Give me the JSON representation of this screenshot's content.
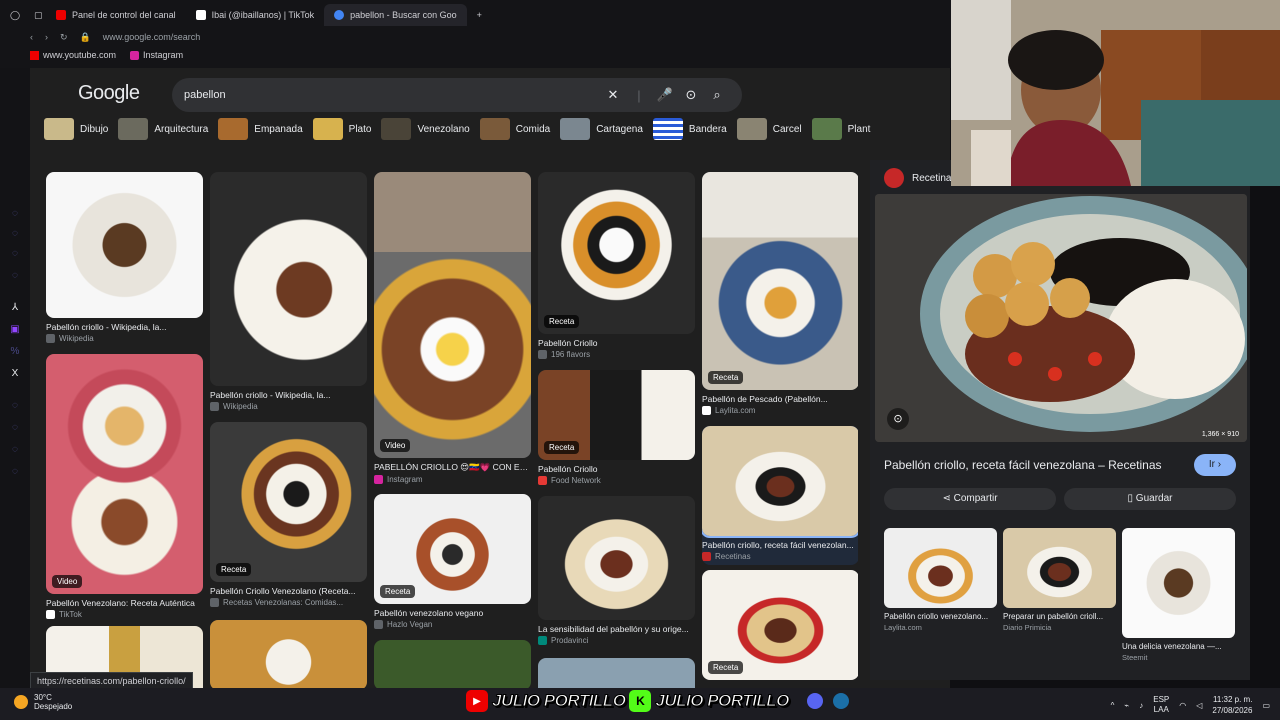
{
  "browser": {
    "tabs": [
      {
        "label": "Panel de control del canal",
        "color": "#e00"
      },
      {
        "label": "Ibai (@ibaillanos) | TikTok",
        "color": "#fff"
      },
      {
        "label": "pabellon - Buscar con Goo",
        "color": "#4285f4",
        "active": true
      }
    ],
    "url": "www.google.com/search",
    "bookmarks": [
      "www.youtube.com",
      "Instagram"
    ]
  },
  "google": {
    "logo": "Google",
    "query": "pabellon",
    "chips": [
      "Dibujo",
      "Arquitectura",
      "Empanada",
      "Plato",
      "Venezolano",
      "Comida",
      "Cartagena",
      "Bandera",
      "Carcel",
      "Plant"
    ]
  },
  "results": [
    {
      "title": "Pabellón criollo - Wikipedia, la...",
      "source": "Wikipedia",
      "badge": ""
    },
    {
      "title": "Pabellón Venezolano: Receta Auténtica",
      "source": "TikTok",
      "badge": "Video"
    },
    {
      "title": "Pabellón criollo - Wikipedia, la...",
      "source": "Wikipedia",
      "badge": ""
    },
    {
      "title": "Pabellón Criollo Venezolano (Receta...",
      "source": "Recetas Venezolanas: Comidas...",
      "badge": "Receta"
    },
    {
      "title": "PABELLÓN CRIOLLO 😍🇻🇪💗 CON EL...",
      "source": "Instagram",
      "badge": "Video"
    },
    {
      "title": "Pabellón venezolano vegano",
      "source": "Hazlo Vegan",
      "badge": "Receta"
    },
    {
      "title": "Pabellón Criollo",
      "source": "196 flavors",
      "badge": "Receta"
    },
    {
      "title": "Pabellón Criollo",
      "source": "Food Network",
      "badge": "Receta"
    },
    {
      "title": "La sensibilidad del pabellón y su orige...",
      "source": "Prodavinci",
      "badge": ""
    },
    {
      "title": "Pabellón de Pescado (Pabellón...",
      "source": "Laylita.com",
      "badge": "Receta"
    },
    {
      "title": "Pabellón criollo, receta fácil venezolan...",
      "source": "Recetinas",
      "badge": ""
    },
    {
      "title": "",
      "source": "",
      "badge": "Receta"
    }
  ],
  "panel": {
    "source": "Recetinas",
    "dims": "1,366 × 910",
    "title": "Pabellón criollo, receta fácil venezolana – Recetinas",
    "go": "Ir",
    "share": "Compartir",
    "save": "Guardar",
    "related": [
      {
        "title": "Pabellón criollo venezolano...",
        "source": "Laylita.com"
      },
      {
        "title": "Preparar un pabellón crioll...",
        "source": "Diario Primicia"
      },
      {
        "title": "Una delicia venezolana —...",
        "source": "Steemit"
      }
    ]
  },
  "status_url": "https://recetinas.com/pabellon-criollo/",
  "taskbar": {
    "temp": "30°C",
    "weather": "Despejado",
    "streamer1": "JULIO PORTILLO",
    "streamer2": "JULIO PORTILLO",
    "lang1": "ESP",
    "lang2": "LAA",
    "time": "11:32 p. m.",
    "date": "27/08/2026"
  }
}
